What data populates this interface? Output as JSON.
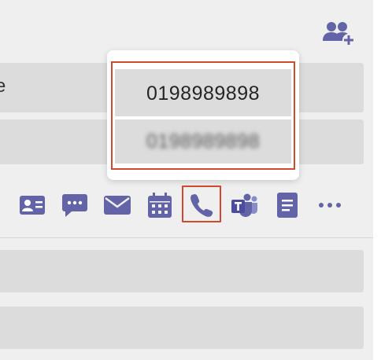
{
  "window": {
    "row1_partial_text": "e"
  },
  "popup": {
    "phone_numbers": [
      {
        "label": "0198989898",
        "redacted": false
      },
      {
        "label": "0198989898",
        "redacted": true
      }
    ]
  },
  "actions": {
    "items": [
      {
        "icon": "contact-card-icon"
      },
      {
        "icon": "chat-icon"
      },
      {
        "icon": "mail-icon"
      },
      {
        "icon": "calendar-icon"
      },
      {
        "icon": "phone-icon",
        "highlighted": true
      },
      {
        "icon": "teams-icon"
      },
      {
        "icon": "document-icon"
      },
      {
        "icon": "more-icon"
      }
    ]
  },
  "colors": {
    "accent": "#6264a7",
    "highlight_border": "#d04a30",
    "row_background": "#dcdcdc",
    "panel_background": "#efefef"
  }
}
